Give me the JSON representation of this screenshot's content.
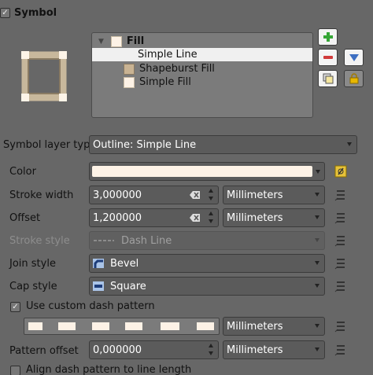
{
  "group": {
    "title": "Symbol",
    "checked": true
  },
  "tree": {
    "root": "Fill",
    "items": [
      {
        "label": "Simple Line",
        "selected": true
      },
      {
        "label": "Shapeburst Fill",
        "selected": false
      },
      {
        "label": "Simple Fill",
        "selected": false
      }
    ]
  },
  "form": {
    "symbol_layer_type_label": "Symbol layer type",
    "symbol_layer_type_value": "Outline: Simple Line",
    "color_label": "Color",
    "color_value": "#fdf2e6",
    "stroke_width_label": "Stroke width",
    "stroke_width_value": "3,000000",
    "stroke_width_unit": "Millimeters",
    "offset_label": "Offset",
    "offset_value": "1,200000",
    "offset_unit": "Millimeters",
    "stroke_style_label": "Stroke style",
    "stroke_style_value": "Dash Line",
    "join_style_label": "Join style",
    "join_style_value": "Bevel",
    "cap_style_label": "Cap style",
    "cap_style_value": "Square",
    "custom_dash_label": "Use custom dash pattern",
    "custom_dash_checked": true,
    "dash_unit": "Millimeters",
    "pattern_offset_label": "Pattern offset",
    "pattern_offset_value": "0,000000",
    "pattern_offset_unit": "Millimeters",
    "align_dash_label": "Align dash pattern to line length",
    "align_dash_checked": false
  },
  "icons": {
    "add": "plus-icon",
    "remove": "minus-icon",
    "move_down": "arrow-down-icon",
    "duplicate": "duplicate-icon",
    "lock": "lock-icon",
    "data_defined": "data-defined-icon",
    "clear": "clear-icon"
  },
  "colors": {
    "swatch": "#fdf2e6",
    "add_green": "#35a535",
    "remove_red": "#d03a3a",
    "down_blue": "#3d6fc2"
  }
}
